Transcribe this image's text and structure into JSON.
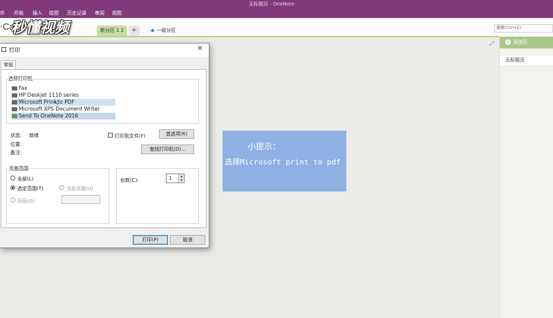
{
  "window": {
    "title": "无标题页 - OneNote"
  },
  "ribbon": {
    "tabs": [
      "件",
      "开始",
      "插入",
      "绘图",
      "历史记录",
      "审阅",
      "视图"
    ]
  },
  "watermark": "秒懂视频",
  "notebook": {
    "name": "Ca",
    "sections": {
      "active": "新分区 1 2",
      "add": "+",
      "group": "一级分区"
    }
  },
  "search": {
    "placeholder": "搜索(Ctrl+E)"
  },
  "page_pane": {
    "add_page": "添加页",
    "pages": [
      "无标题页"
    ]
  },
  "tip": {
    "title": "小提示：",
    "text": "选择Microsoft print to pdf"
  },
  "print_dialog": {
    "title": "打印",
    "close": "✕",
    "tab": "常规",
    "select_printer_label": "选择打印机",
    "printers": [
      {
        "name": "Fax",
        "state": "normal"
      },
      {
        "name": "HP Deskjet 1110 series",
        "state": "normal"
      },
      {
        "name": "Microsoft Print to PDF",
        "state": "highlight"
      },
      {
        "name": "Microsoft XPS Document Writer",
        "state": "normal"
      },
      {
        "name": "Send To OneNote 2016",
        "state": "selected"
      }
    ],
    "status_label": "状态:",
    "status_value": "就绪",
    "location_label": "位置:",
    "comment_label": "备注:",
    "print_to_file": "打印到文件(F)",
    "preferences_button": "首选项(R)",
    "find_printer_button": "查找打印机(D)...",
    "page_range": {
      "title": "页面范围",
      "all": "全部(L)",
      "selection": "选定范围(T)",
      "current_page": "当前页面(U)",
      "pages": "页码(G):"
    },
    "copies_label": "份数(C):",
    "copies_value": "1",
    "print_button": "打印(P)",
    "cancel_button": "取消"
  },
  "colors": {
    "ribbon": "#80397b",
    "section_active": "#c7dca2",
    "tip_background": "#8eb0e2",
    "add_page": "#a9c88a"
  }
}
